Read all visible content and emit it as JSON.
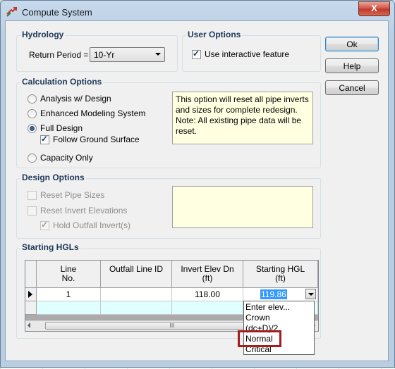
{
  "window": {
    "title": "Compute System",
    "close_glyph": "X"
  },
  "hydrology": {
    "title": "Hydrology",
    "return_period_label": "Return Period =",
    "return_period_value": "10-Yr"
  },
  "user_options": {
    "title": "User Options",
    "interactive_label": "Use interactive feature",
    "interactive_checked": true
  },
  "buttons": {
    "ok": "Ok",
    "help": "Help",
    "cancel": "Cancel"
  },
  "calc": {
    "title": "Calculation Options",
    "options": [
      "Analysis w/ Design",
      "Enhanced Modeling System",
      "Full Design",
      "Capacity Only"
    ],
    "selected": "Full Design",
    "follow_ground": "Follow Ground Surface",
    "note": "This option will reset all pipe inverts and sizes for complete redesign. Note: All existing pipe data will be reset."
  },
  "design": {
    "title": "Design Options",
    "reset_pipe": "Reset Pipe Sizes",
    "reset_invert": "Reset Invert Elevations",
    "hold_outfall": "Hold Outfall Invert(s)"
  },
  "hgl": {
    "title": "Starting HGLs",
    "columns": [
      "Line\nNo.",
      "Outfall Line ID",
      "Invert Elev Dn\n(ft)",
      "Starting HGL\n(ft)"
    ],
    "rows": [
      {
        "line": "1",
        "outfall_id": "",
        "invert": "118.00",
        "hgl": "119.86"
      }
    ],
    "scroll_grip": "III"
  },
  "dropdown": {
    "items": [
      "Enter elev...",
      "Crown",
      "(dc+D)/2",
      "Normal",
      "Critical"
    ],
    "highlighted": "Normal"
  }
}
